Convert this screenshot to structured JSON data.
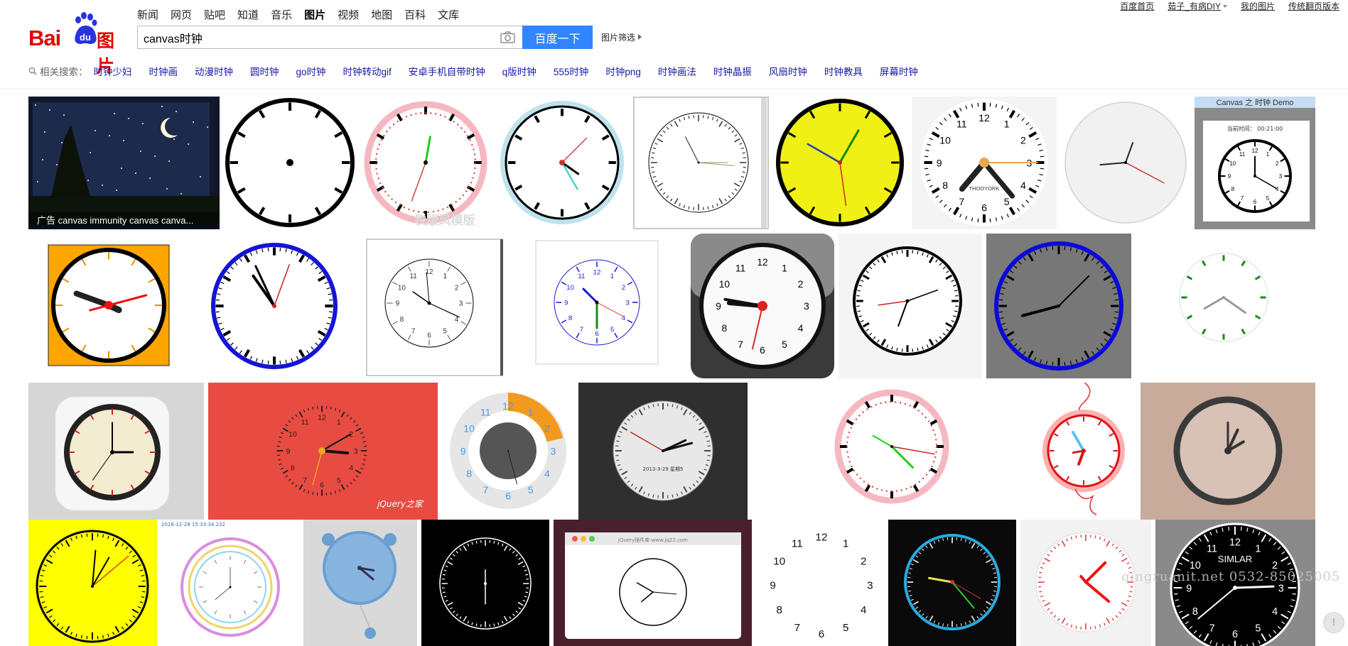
{
  "logo": {
    "text_latin": "Bai",
    "paw_text": "du",
    "text_cn": "图片"
  },
  "nav": [
    {
      "label": "新闻",
      "active": false
    },
    {
      "label": "网页",
      "active": false
    },
    {
      "label": "贴吧",
      "active": false
    },
    {
      "label": "知道",
      "active": false
    },
    {
      "label": "音乐",
      "active": false
    },
    {
      "label": "图片",
      "active": true
    },
    {
      "label": "视频",
      "active": false
    },
    {
      "label": "地图",
      "active": false
    },
    {
      "label": "百科",
      "active": false
    },
    {
      "label": "文库",
      "active": false
    }
  ],
  "search": {
    "value": "canvas时钟",
    "button_label": "百度一下",
    "filter_label": "图片筛选"
  },
  "top_links": {
    "home": "百度首页",
    "user": "茹子_有病DIY",
    "my_images": "我的图片",
    "classic": "传统翻页版本"
  },
  "related": {
    "label": "相关搜索：",
    "items": [
      "时钟少妇",
      "时钟画",
      "动漫时钟",
      "圆时钟",
      "go时钟",
      "时钟转动gif",
      "安卓手机自带时钟",
      "q版时钟",
      "555时钟",
      "时钟png",
      "时钟画法",
      "时钟晶振",
      "风扇时钟",
      "时钟教具",
      "屏幕时钟"
    ]
  },
  "ad_caption": "广告   canvas immunity canvas canva...",
  "watermark": "qingruanit.net 0532-85025005",
  "tile_texts": {
    "t9_title": "Canvas 之 时钟 Demo",
    "t9_time": "当前时间：  00:21:00",
    "t22_brand": "jQuery之家",
    "t23_date": "2013-3-29  星期5",
    "t26_date": "2016-12-28 15:33:34.232",
    "t29_url": "jQuery插件库-www.jq22.com",
    "t32_brand": "SIMLAR",
    "t7_brand": "THOOYORK",
    "t3_wm": "锐版风模版"
  },
  "colors": {
    "accent_blue": "#3385ff",
    "logo_red": "#e10601",
    "link_blue": "#1a1aa6"
  },
  "feedback_icon": "!"
}
